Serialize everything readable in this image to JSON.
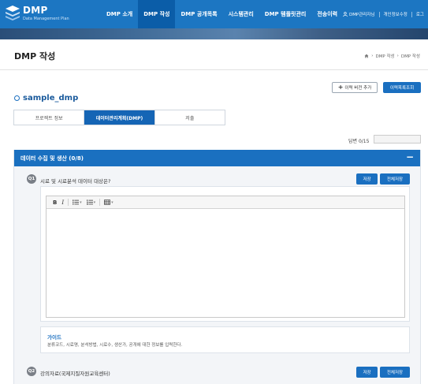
{
  "header": {
    "logo_title": "DMP",
    "logo_sub": "Data Management Plan",
    "nav": [
      {
        "label": "DMP 소개"
      },
      {
        "label": "DMP 작성"
      },
      {
        "label": "DMP 공개목록"
      },
      {
        "label": "시스템관리"
      },
      {
        "label": "DMP 템플릿관리"
      },
      {
        "label": "전송이력"
      }
    ],
    "active_nav": "DMP 작성",
    "util": {
      "admin_label": "DMP관리자님",
      "profile_label": "개인정보수정",
      "logout_label": "로그"
    }
  },
  "page": {
    "title": "DMP 작성",
    "breadcrumb": [
      "DMP 작성",
      "DMP 작성"
    ]
  },
  "actions": {
    "add_history": "이력 버전 추가",
    "view_history": "이력목록조회"
  },
  "project": {
    "name": "sample_dmp"
  },
  "tabs": [
    {
      "label": "프로젝트 정보",
      "active": false
    },
    {
      "label": "데이터관리계획(DMP)",
      "active": true
    },
    {
      "label": "저출",
      "active": false
    }
  ],
  "answer_count": {
    "label": "답변 0/15",
    "value": ""
  },
  "section": {
    "title": "데이터 수집 및 생산 (0/8)",
    "collapse_symbol": "−"
  },
  "questions": [
    {
      "badge": "Q1",
      "text": "시료 및 시료분석 데이터 대상은?",
      "save": "저장",
      "save_all": "전체저장"
    },
    {
      "badge": "Q2",
      "text": "강의자료(국제지질자원교육센터)",
      "save": "저장",
      "save_all": "전체저장"
    }
  ],
  "editor": {
    "bold": "B",
    "italic": "I",
    "content": ""
  },
  "guide": {
    "title": "가이드",
    "text": "분류코드, 시료명, 분석방법, 시료수, 생산가, 공개에 대한 정보를 입력한다."
  },
  "colors": {
    "header_bg": "#1c76c2",
    "nav_active": "#0b5da8",
    "accent": "#1a6fc0",
    "section_bg": "#f3f5f8"
  }
}
